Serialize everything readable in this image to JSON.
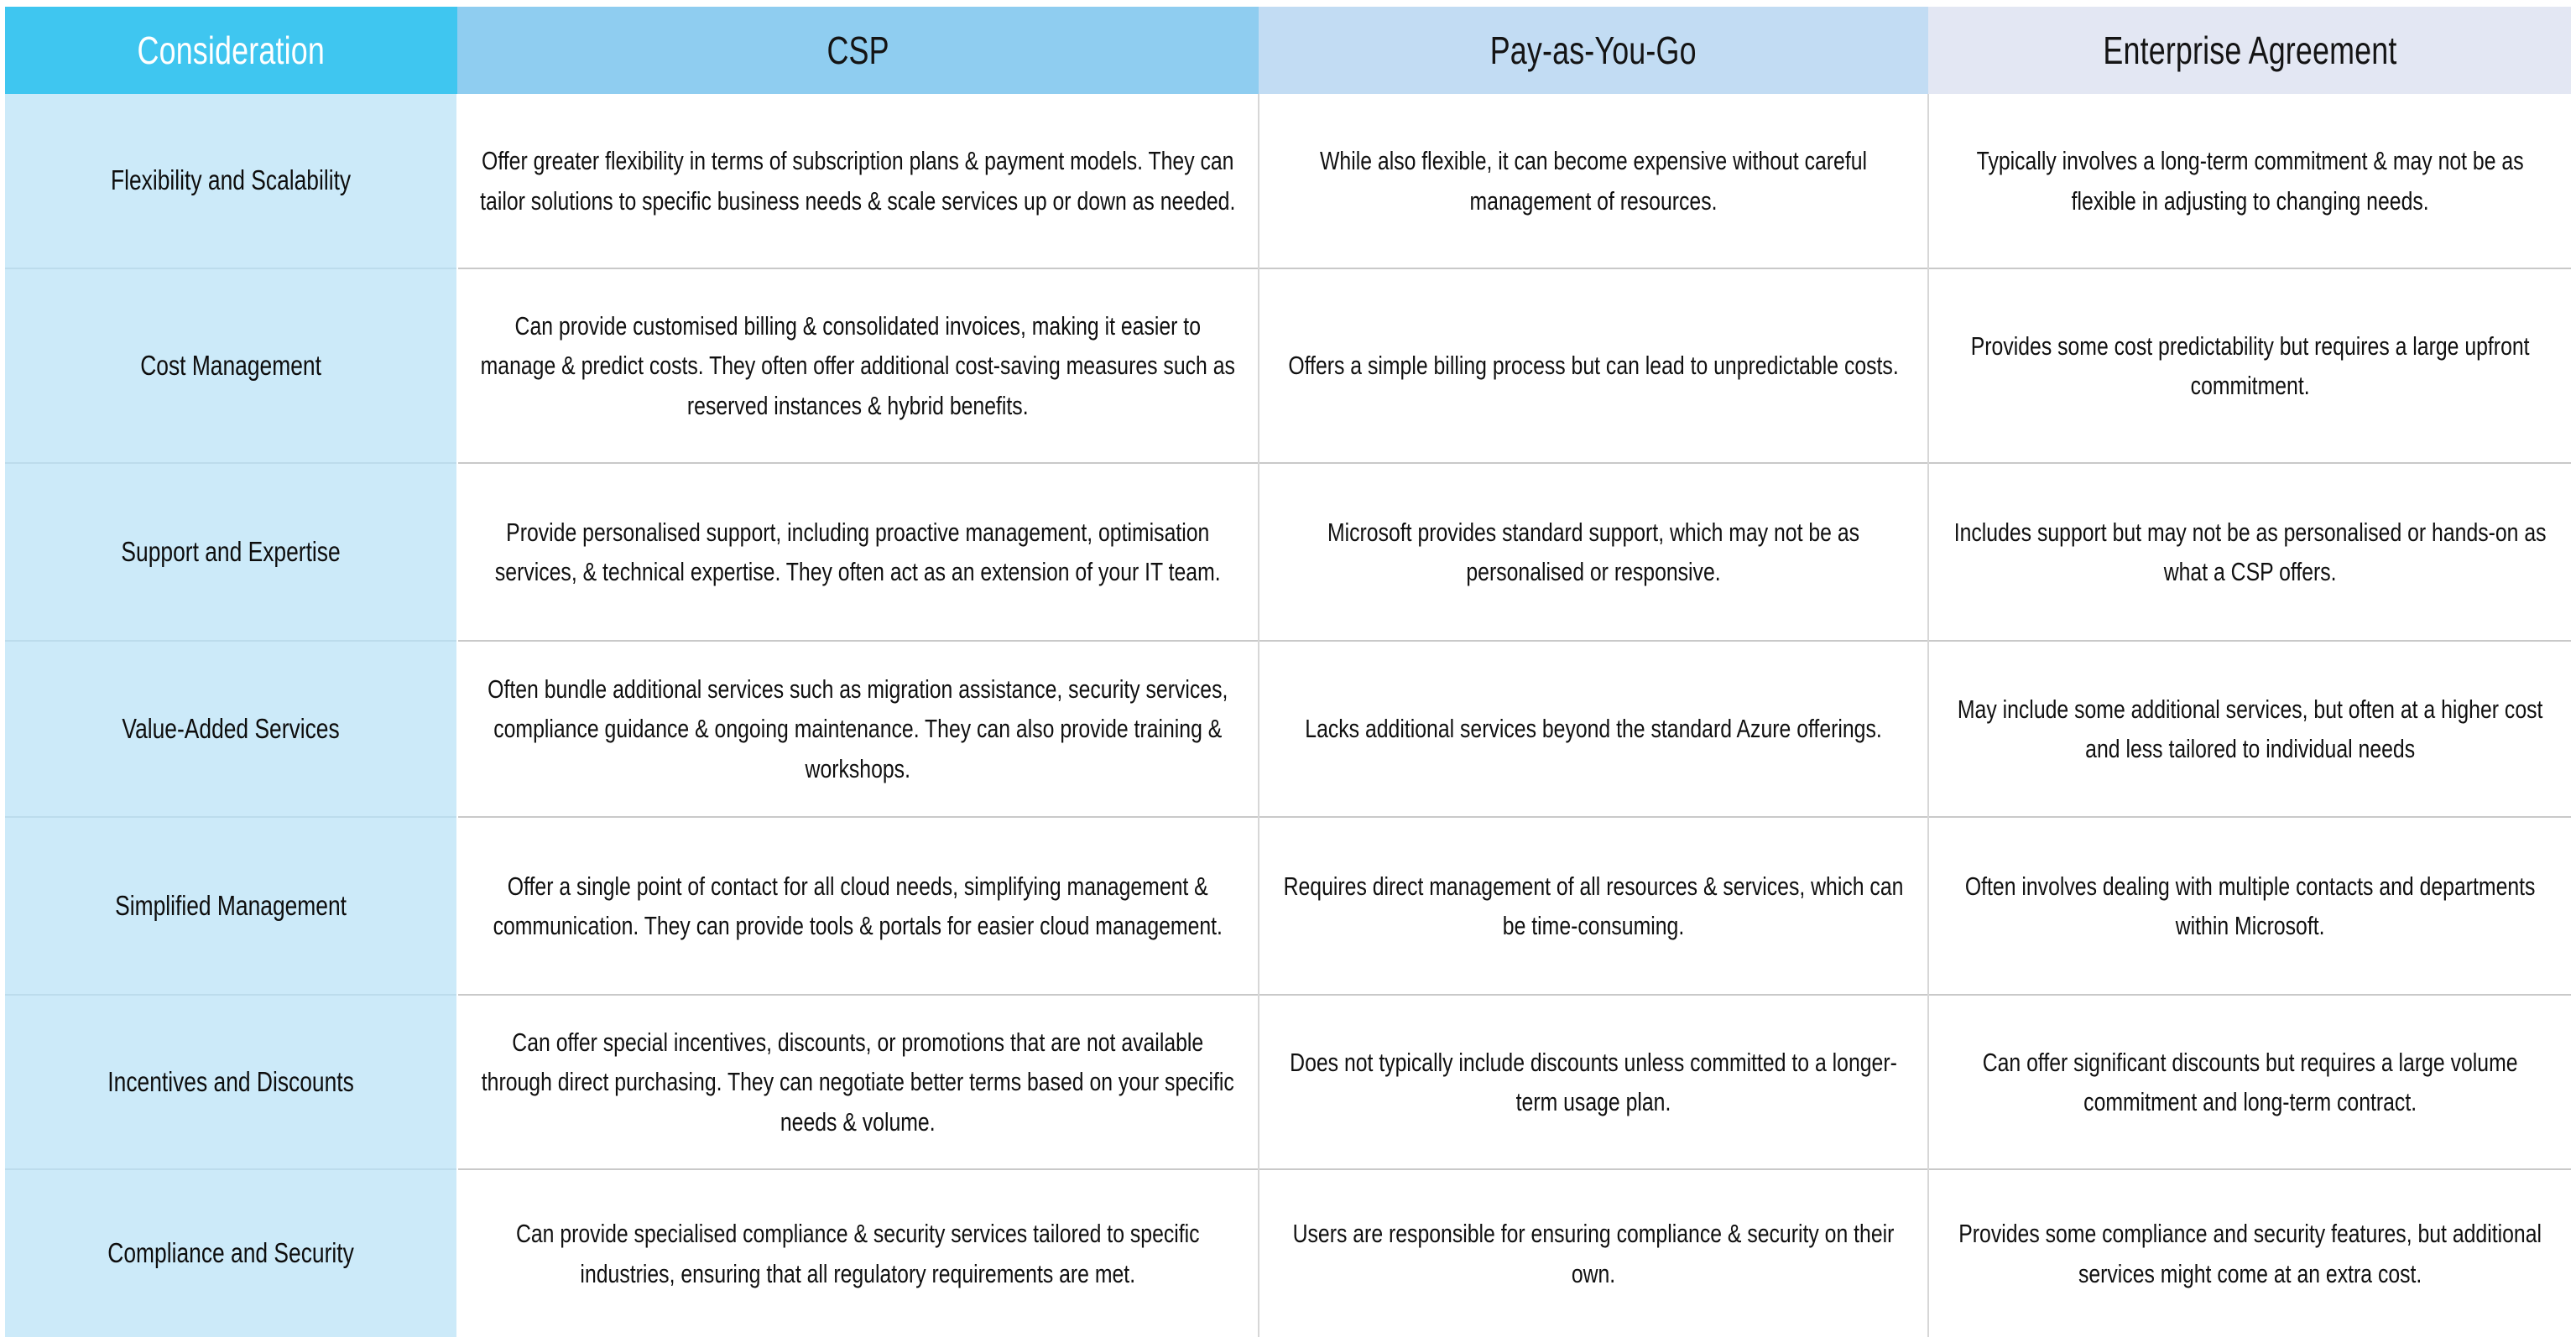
{
  "table": {
    "columns": [
      {
        "key": "consideration",
        "label": "Consideration"
      },
      {
        "key": "csp",
        "label": "CSP"
      },
      {
        "key": "payg",
        "label": "Pay-as-You-Go"
      },
      {
        "key": "ea",
        "label": "Enterprise Agreement"
      }
    ],
    "header_colors": {
      "consideration_bg": "#3FC6F0",
      "consideration_text": "#FFFFFF",
      "csp_bg": "#8FCDF0",
      "payg_bg": "#C2DCF3",
      "ea_bg": "#E3E7F3",
      "row_head_bg": "#CCEAF9",
      "cell_bg": "#FFFFFF",
      "grid_line": "#C9C9C9"
    },
    "rows": [
      {
        "consideration": "Flexibility and Scalability",
        "csp": "Offer greater flexibility in terms of subscription plans & payment models. They can tailor solutions to specific business needs & scale services up or down as needed.",
        "payg": "While also flexible, it can become expensive without careful management of resources.",
        "ea": "Typically involves a long-term commitment & may not be as flexible in adjusting to changing needs."
      },
      {
        "consideration": "Cost Management",
        "csp": "Can provide customised billing & consolidated invoices, making it easier to manage & predict costs. They often offer additional cost-saving measures such as reserved instances & hybrid benefits.",
        "payg": "Offers a simple billing process but can lead to unpredictable costs.",
        "ea": "Provides some cost predictability but requires a large upfront commitment."
      },
      {
        "consideration": "Support and Expertise",
        "csp": "Provide personalised support, including proactive management, optimisation services, & technical expertise. They often act as an extension of your IT team.",
        "payg": "Microsoft provides standard support, which may not be as personalised or responsive.",
        "ea": "Includes support but may not be as personalised or hands-on as what a CSP offers."
      },
      {
        "consideration": "Value-Added Services",
        "csp": "Often bundle additional services such as migration assistance, security services, compliance guidance & ongoing maintenance. They can also provide training & workshops.",
        "payg": "Lacks additional services beyond the standard Azure offerings.",
        "ea": "May include some additional services, but often at a higher cost and less tailored to individual needs"
      },
      {
        "consideration": "Simplified Management",
        "csp": "Offer a single point of contact for all cloud needs, simplifying management &\ncommunication. They can provide tools & portals for easier cloud management.",
        "payg": "Requires direct management of all resources & services, which can be time-consuming.",
        "ea": "Often involves dealing with multiple contacts and departments within Microsoft."
      },
      {
        "consideration": "Incentives and Discounts",
        "csp": "Can offer special incentives, discounts, or promotions that are not available through direct purchasing. They can negotiate better terms based on your specific needs & volume.",
        "payg": "Does not typically include discounts unless committed to a longer-term usage plan.",
        "ea": "Can offer significant discounts but requires a large volume commitment and long-term contract."
      },
      {
        "consideration": "Compliance and Security",
        "csp": "Can provide specialised compliance & security services tailored to specific industries, ensuring that all regulatory requirements are met.",
        "payg": "Users are responsible for ensuring compliance & security on their own.",
        "ea": "Provides some compliance and security features, but additional services might come at an extra cost."
      }
    ]
  }
}
